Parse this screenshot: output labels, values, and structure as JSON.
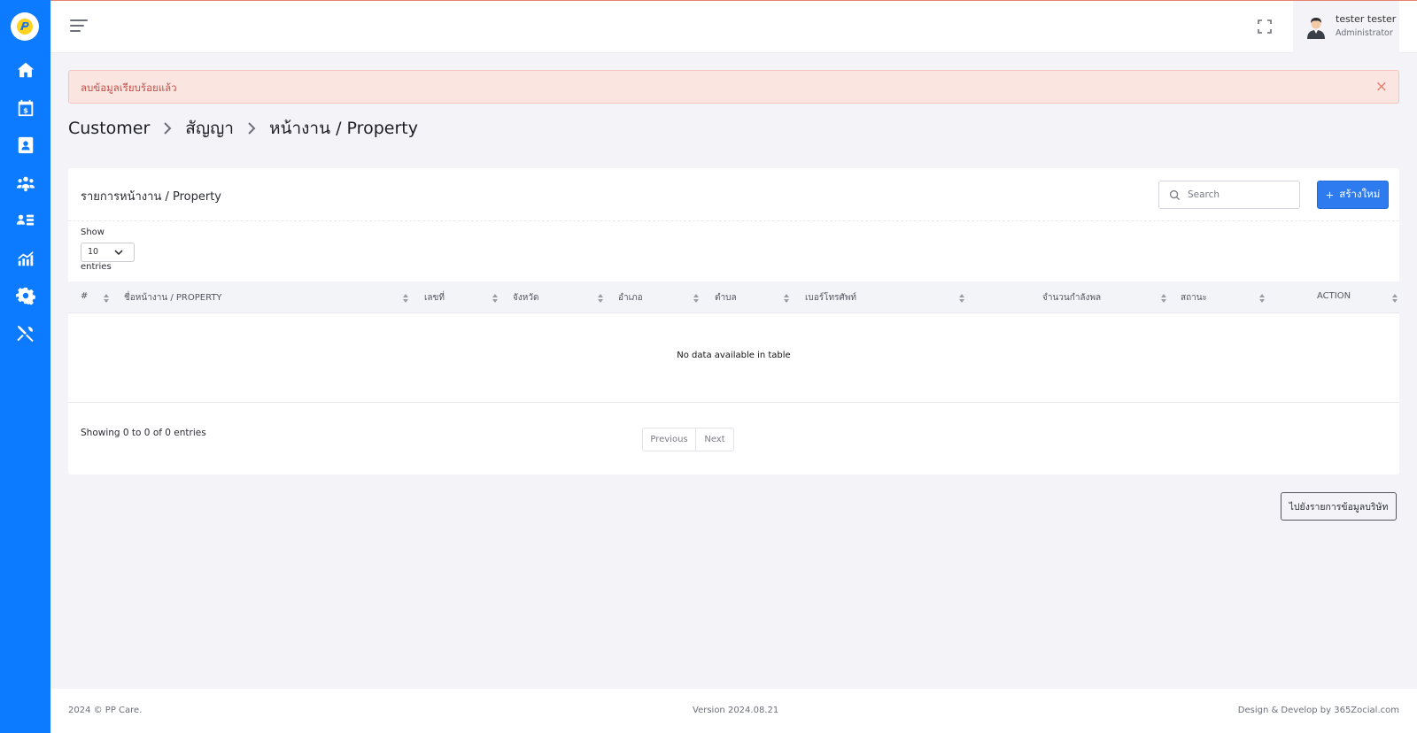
{
  "sidebar": {
    "logo": "pp-care-logo",
    "items": [
      {
        "icon": "home-icon"
      },
      {
        "icon": "billing-calendar-icon"
      },
      {
        "icon": "contacts-book-icon"
      },
      {
        "icon": "team-icon"
      },
      {
        "icon": "user-list-icon"
      },
      {
        "icon": "analytics-chart-icon"
      },
      {
        "icon": "settings-gear-icon"
      },
      {
        "icon": "tools-icon"
      }
    ],
    "bg_color": "#0d7bff"
  },
  "header": {
    "user_name": "tester tester",
    "user_role": "Administrator"
  },
  "alert": {
    "text": "ลบข้อมูลเรียบร้อยแล้ว",
    "close": "×",
    "color": "#c0524a"
  },
  "breadcrumb": {
    "items": [
      "Customer",
      "สัญญา",
      "หน้างาน / Property"
    ]
  },
  "card": {
    "title": "รายการหน้างาน / Property",
    "search_placeholder": "Search",
    "create_label": "สร้างใหม่",
    "create_icon": "+",
    "accent": "#2d7bef"
  },
  "table": {
    "show_label": "Show",
    "page_size": "10",
    "entries_label": "entries",
    "columns": [
      "#",
      "ชื่อหน้างาน / PROPERTY",
      "เลขที่",
      "จังหวัด",
      "อำเภอ",
      "ตำบล",
      "เบอร์โทรศัพท์",
      "จำนวนกำลังพล",
      "สถานะ",
      "ACTION"
    ],
    "empty_text": "No data available in table",
    "info": "Showing 0 to 0 of 0 entries",
    "prev_label": "Previous",
    "next_label": "Next"
  },
  "goto_label": "ไปยังรายการข้อมูลบริษัท",
  "footer": {
    "copyright": "2024 © PP Care.",
    "version": "Version 2024.08.21",
    "credit": "Design & Develop by 365Zocial.com"
  }
}
